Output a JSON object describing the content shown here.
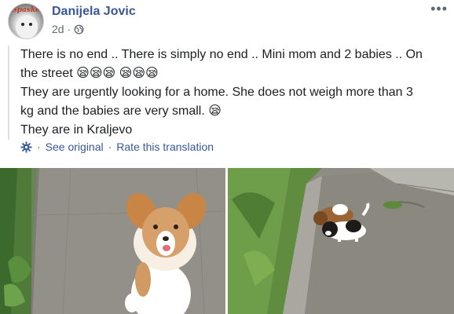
{
  "post": {
    "author": "Danijela Jovic",
    "timestamp": "2d",
    "separator": "·",
    "avatar_text": "Spaske",
    "lines": [
      "There is no end .. There is simply no end .. Mini mom and 2 babies .. On",
      "the street 😪😪😪 😪😪😪",
      "They are urgently looking for a home. She does not weigh more than 3",
      "kg and the babies are very small. 😪",
      "They are in Kraljevo"
    ],
    "translation": {
      "see_original": "See original",
      "rate": "Rate this translation",
      "dot": "·"
    },
    "more_icon": "•••"
  },
  "photos": [
    {
      "subject": "small tan and white dog standing on its hind legs on pavement"
    },
    {
      "subject": "two puppies, brown-and-white and black-and-white, on concrete path beside grass"
    }
  ],
  "colors": {
    "link": "#385898",
    "text": "#1c1e21",
    "secondary": "#606770"
  },
  "icons": [
    "globe-icon",
    "gear-icon",
    "more-options-icon"
  ]
}
